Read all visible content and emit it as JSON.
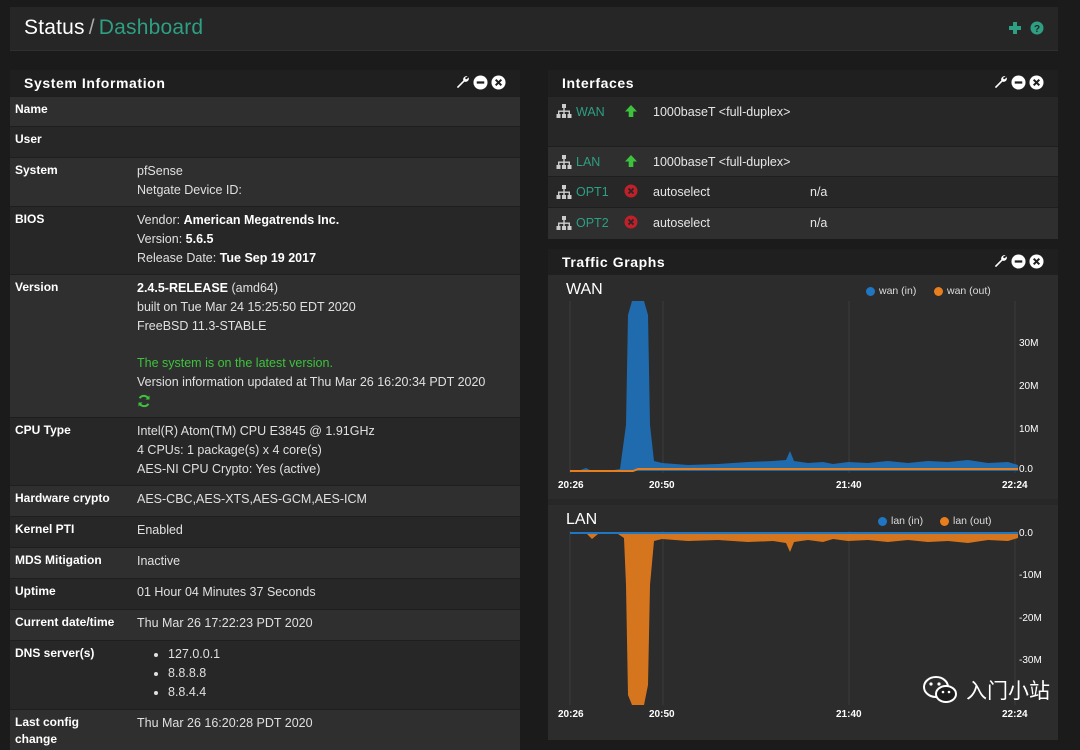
{
  "breadcrumb": {
    "status": "Status",
    "separator": "/",
    "current": "Dashboard"
  },
  "system_info": {
    "title": "System Information",
    "rows": [
      {
        "label": "Name",
        "lines": []
      },
      {
        "label": "User",
        "lines": []
      },
      {
        "label": "System",
        "lines": [
          "pfSense",
          "Netgate Device ID:"
        ]
      },
      {
        "label": "BIOS",
        "lines": [
          "Vendor: American Megatrends Inc.",
          "Version: 5.6.5",
          "Release Date: Tue Sep 19 2017"
        ]
      },
      {
        "label": "Version",
        "lines": [
          "2.4.5-RELEASE (amd64)",
          "built on Tue Mar 24 15:25:50 EDT 2020",
          "FreeBSD 11.3-STABLE",
          "",
          "The system is on the latest version.",
          "Version information updated at Thu Mar 26 16:20:34 PDT 2020"
        ]
      },
      {
        "label": "CPU Type",
        "lines": [
          "Intel(R) Atom(TM) CPU E3845 @ 1.91GHz",
          "4 CPUs: 1 package(s) x 4 core(s)",
          "AES-NI CPU Crypto: Yes (active)"
        ]
      },
      {
        "label": "Hardware crypto",
        "lines": [
          "AES-CBC,AES-XTS,AES-GCM,AES-ICM"
        ]
      },
      {
        "label": "Kernel PTI",
        "lines": [
          "Enabled"
        ]
      },
      {
        "label": "MDS Mitigation",
        "lines": [
          "Inactive"
        ]
      },
      {
        "label": "Uptime",
        "lines": [
          "01 Hour 04 Minutes 37 Seconds"
        ]
      },
      {
        "label": "Current date/time",
        "lines": [
          "Thu Mar 26 17:22:23 PDT 2020"
        ]
      },
      {
        "label": "DNS server(s)",
        "lines": [
          "127.0.0.1",
          "8.8.8.8",
          "8.8.4.4"
        ]
      },
      {
        "label": "Last config change",
        "lines": [
          "Thu Mar 26 16:20:28 PDT 2020"
        ]
      }
    ]
  },
  "bios_strong": {
    "vendor_prefix": "Vendor: ",
    "vendor": "American Megatrends Inc.",
    "version_prefix": "Version: ",
    "version": "5.6.5",
    "date_prefix": "Release Date: ",
    "date": "Tue Sep 19 2017"
  },
  "version_strong": {
    "release": "2.4.5-RELEASE",
    "arch": " (amd64)"
  },
  "interfaces": {
    "title": "Interfaces",
    "rows": [
      {
        "name": "WAN",
        "status": "up",
        "media": "1000baseT <full-duplex>",
        "ip": ""
      },
      {
        "name": "LAN",
        "status": "up",
        "media": "1000baseT <full-duplex>",
        "ip": ""
      },
      {
        "name": "OPT1",
        "status": "down",
        "media": "autoselect",
        "ip": "n/a"
      },
      {
        "name": "OPT2",
        "status": "down",
        "media": "autoselect",
        "ip": "n/a"
      }
    ]
  },
  "traffic": {
    "title": "Traffic Graphs",
    "colors": {
      "in": "#1f77c4",
      "out": "#e87e1e"
    },
    "wan": {
      "title": "WAN",
      "legend_in": "wan (in)",
      "legend_out": "wan (out)",
      "yticks": [
        "30M",
        "20M",
        "10M",
        "0.0"
      ],
      "xticks": [
        "20:26",
        "20:50",
        "21:40",
        "22:24"
      ]
    },
    "lan": {
      "title": "LAN",
      "legend_in": "lan (in)",
      "legend_out": "lan (out)",
      "yticks": [
        "0.0",
        "-10M",
        "-20M",
        "-30M"
      ],
      "xticks": [
        "20:26",
        "20:50",
        "21:40",
        "22:24"
      ]
    }
  },
  "watermark": "入门小站",
  "icons": [
    "plus-icon",
    "help-icon",
    "wrench-icon",
    "minus-icon",
    "close-icon",
    "network-icon",
    "arrow-up-icon",
    "down-x-icon",
    "refresh-icon"
  ]
}
